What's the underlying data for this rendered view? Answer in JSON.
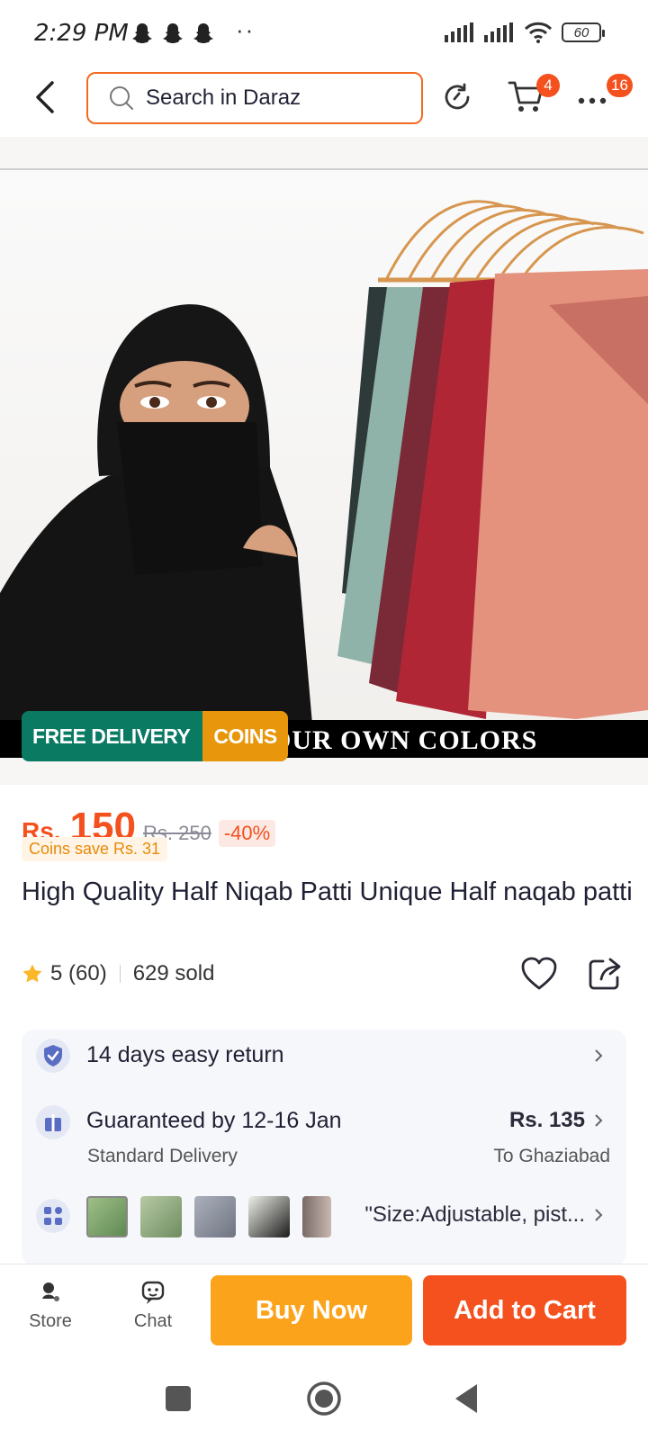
{
  "status_bar": {
    "time": "2:29 PM",
    "overflow": "··",
    "battery": "60",
    "notification_icons": [
      "snapchat-icon",
      "snapchat-icon",
      "snapchat-icon"
    ]
  },
  "header": {
    "search_placeholder": "Search in Daraz",
    "cart_badge": "4",
    "more_badge": "16"
  },
  "gallery": {
    "banner_text": "OUR OWN COLORS",
    "promo_free_delivery": "FREE DELIVERY",
    "promo_coins": "COINS"
  },
  "product": {
    "currency": "Rs.",
    "price": "150",
    "original_price": "Rs. 250",
    "discount": "-40%",
    "coins_save": "Coins save Rs. 31",
    "title": "High Quality Half Niqab Patti Unique Half naqab patti",
    "rating": "5 (60)",
    "sold": "629 sold"
  },
  "info": {
    "return_text": "14 days easy return",
    "delivery_text": "Guaranteed by 12-16 Jan",
    "delivery_type": "Standard Delivery",
    "delivery_fee": "Rs. 135",
    "destination": "To Ghaziabad",
    "variant_text": "\"Size:Adjustable, pist..."
  },
  "bottom_bar": {
    "store_label": "Store",
    "chat_label": "Chat",
    "buy_now": "Buy Now",
    "add_to_cart": "Add to Cart"
  },
  "colors": {
    "brand_orange": "#f4511e",
    "buy_now_yellow": "#fca31c",
    "free_delivery_green": "#0a7a62",
    "coins_orange": "#e8970c"
  }
}
